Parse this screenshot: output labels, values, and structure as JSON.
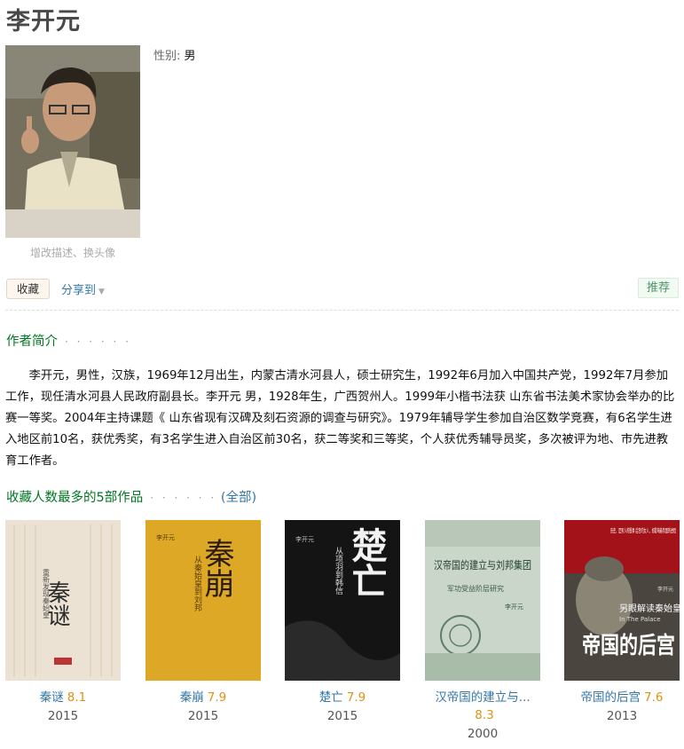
{
  "author": {
    "name": "李开元",
    "gender_label": "性别:",
    "gender_value": "男",
    "photo_links": "增改描述、换头像"
  },
  "actions": {
    "collect": "收藏",
    "share": "分享到",
    "recommend": "推荐"
  },
  "intro": {
    "heading": "作者简介",
    "dots": "· · · · · ·",
    "text": "李开元，男性，汉族，1969年12月出生，内蒙古清水河县人，硕士研究生，1992年6月加入中国共产党，1992年7月参加工作，现任清水河县人民政府副县长。李开元 男，1928年生，广西贺州人。1999年小楷书法获 山东省书法美术家协会举办的比赛一等奖。2004年主持课题《 山东省现有汉碑及刻石资源的调查与研究》。1979年辅导学生参加自治区数学竞赛，有6名学生进入地区前10名，获优秀奖，有3名学生进入自治区前30名，获二等奖和三等奖，个人获优秀辅导员奖，多次被评为地、市先进教育工作者。"
  },
  "works": {
    "heading": "收藏人数最多的5部作品",
    "dots": "· · · · · ·",
    "open_paren": "(",
    "all_link": "全部",
    "close_paren": ")",
    "items": [
      {
        "title": "秦谜",
        "rating": "8.1",
        "year": "2015",
        "cover_text": "秦谜",
        "cover_sub": "重新发现秦始皇"
      },
      {
        "title": "秦崩",
        "rating": "7.9",
        "year": "2015",
        "cover_text": "秦崩",
        "cover_sub": "从秦始皇到刘邦",
        "cover_author": "李开元"
      },
      {
        "title": "楚亡",
        "rating": "7.9",
        "year": "2015",
        "cover_text": "楚亡",
        "cover_sub": "从项羽到韩信",
        "cover_author": "李开元"
      },
      {
        "title": "汉帝国的建立与...",
        "rating": "8.3",
        "year": "2000",
        "cover_text": "汉帝国的建立与刘邦集团",
        "cover_sub": "军功受益阶层研究",
        "cover_author": "李开元"
      },
      {
        "title": "帝国的后宫",
        "rating": "7.6",
        "year": "2013",
        "cover_text": "帝国的后宫",
        "cover_sub": "另眼解读秦始皇",
        "cover_tag": "In The Palace",
        "cover_top": "历史、是男人的殷事 后宫的女人，却影响着帝国的进程",
        "cover_author": "李开元"
      }
    ]
  }
}
